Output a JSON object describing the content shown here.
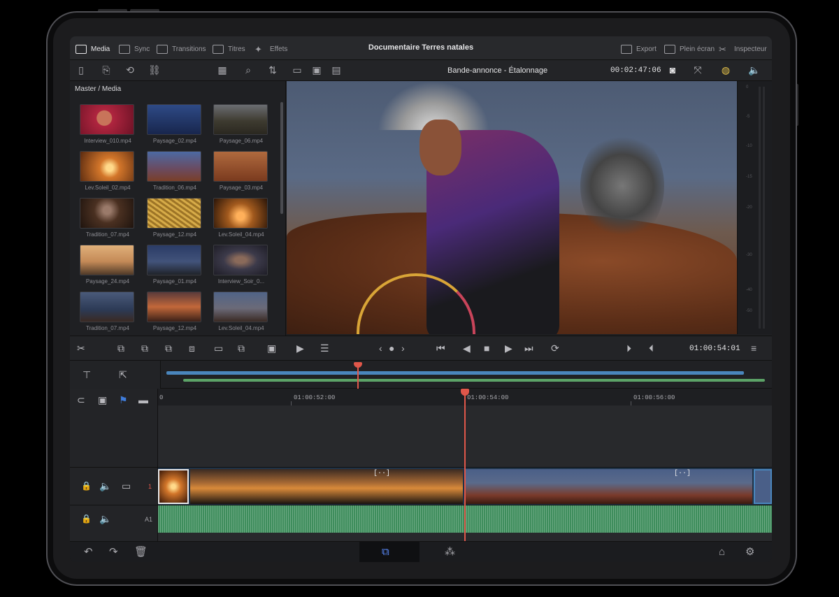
{
  "app": {
    "project_title": "Documentaire Terres natales",
    "timeline_name": "Bande-annonce - Étalonnage",
    "timecode_top": "00:02:47:06",
    "timecode_transport": "01:00:54:01"
  },
  "menu": {
    "left": [
      {
        "label": "Media",
        "icon": "media-icon"
      },
      {
        "label": "Sync",
        "icon": "sync-icon"
      },
      {
        "label": "Transitions",
        "icon": "transitions-icon"
      },
      {
        "label": "Titres",
        "icon": "titles-icon"
      },
      {
        "label": "Effets",
        "icon": "effects-icon"
      }
    ],
    "right": [
      {
        "label": "Export",
        "icon": "export-icon"
      },
      {
        "label": "Plein écran",
        "icon": "fullscreen-icon"
      },
      {
        "label": "Inspecteur",
        "icon": "inspector-icon"
      }
    ]
  },
  "pool": {
    "path": "Master / Media",
    "clips": [
      {
        "name": "Interview_010.mp4",
        "color": "#b0253f"
      },
      {
        "name": "Paysage_02.mp4",
        "color": "#2e4a86"
      },
      {
        "name": "Paysage_06.mp4",
        "color": "#5c5a49"
      },
      {
        "name": "Lev.Soleil_02.mp4",
        "color": "#d3762a"
      },
      {
        "name": "Tradition_06.mp4",
        "color": "#3f5a96"
      },
      {
        "name": "Paysage_03.mp4",
        "color": "#9a4e2e"
      },
      {
        "name": "Tradition_07.mp4",
        "color": "#4a3021"
      },
      {
        "name": "Paysage_12.mp4",
        "color": "#c69b3a"
      },
      {
        "name": "Lev.Soleil_04.mp4",
        "color": "#a25a1e"
      },
      {
        "name": "Paysage_24.mp4",
        "color": "#c48a57"
      },
      {
        "name": "Paysage_01.mp4",
        "color": "#2a3b66"
      },
      {
        "name": "Interview_Soir_0...",
        "color": "#3c3a4a"
      },
      {
        "name": "Tradition_07.mp4",
        "color": "#2c3a55"
      },
      {
        "name": "Paysage_12.mp4",
        "color": "#c2683a"
      },
      {
        "name": "Lev.Soleil_04.mp4",
        "color": "#506487"
      }
    ]
  },
  "timeline": {
    "ruler": [
      "0",
      "01:00:52:00",
      "01:00:54:00",
      "01:00:56:00"
    ],
    "video_track_label": "1",
    "audio_track_label": "A1",
    "marker": "[··]"
  }
}
